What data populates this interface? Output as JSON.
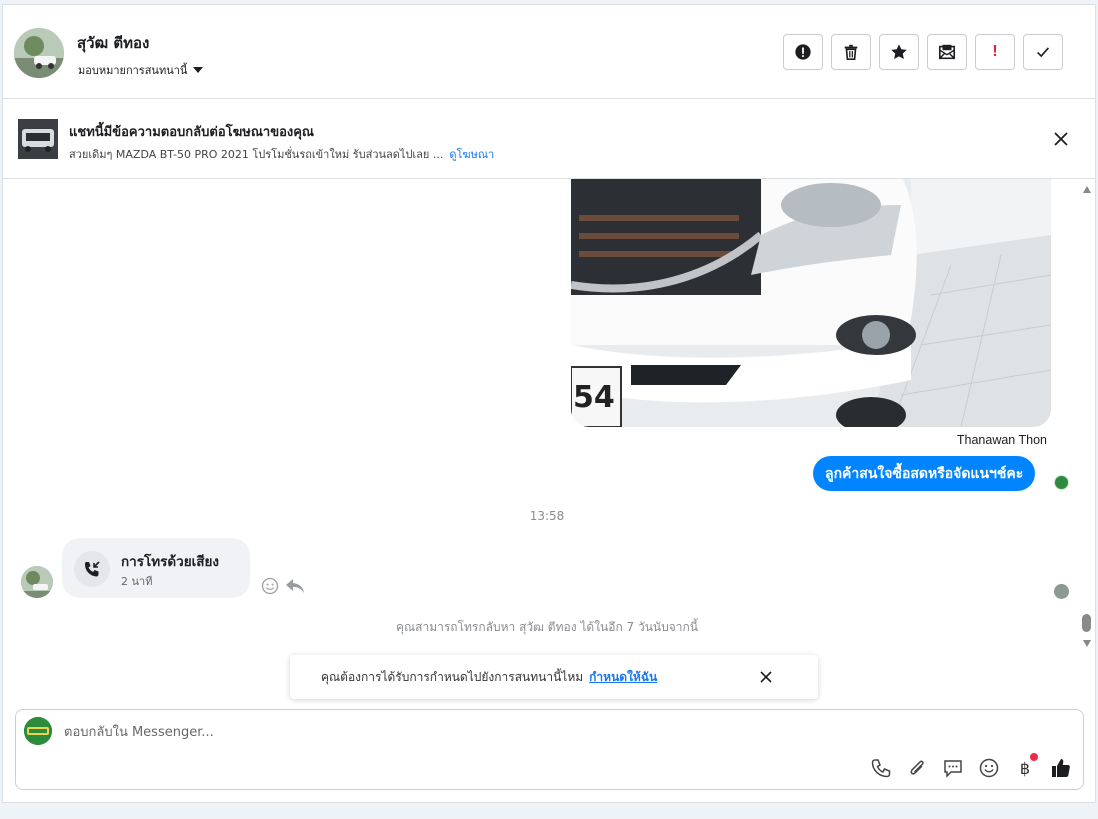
{
  "header": {
    "contact_name": "สุวัฒ ตีทอง",
    "assign_label": "มอบหมายการสนทนานี้",
    "buttons": [
      {
        "name": "report-button",
        "icon": "alert-circle-icon"
      },
      {
        "name": "delete-button",
        "icon": "trash-icon"
      },
      {
        "name": "star-button",
        "icon": "star-icon"
      },
      {
        "name": "mark-unread-button",
        "icon": "envelope-icon"
      },
      {
        "name": "follow-up-button",
        "icon": "exclamation-icon",
        "label": "!"
      },
      {
        "name": "done-button",
        "icon": "check-icon"
      }
    ]
  },
  "ad_banner": {
    "title": "แชทนี้มีข้อความตอบกลับต่อโฆษณาของคุณ",
    "description": "สวยเดิมๆ MAZDA BT-50 PRO 2021 โปรโมชั่นรถเข้าใหม่ รับส่วนลดไปเลย ...",
    "link": "ดูโฆษณา"
  },
  "messages": {
    "photo_plate_text": "54",
    "sender_name": "Thanawan Thon",
    "outgoing_text": "ลูกค้าสนใจซื้อสดหรือจัดแนฯช์คะ",
    "time_divider": "13:58",
    "call": {
      "title": "การโทรด้วยเสียง",
      "duration": "2 นาที"
    },
    "callback_note": "คุณสามารถโทรกลับหา สุวัฒ ตีทอง ได้ในอีก 7 วันนับจากนี้"
  },
  "toast": {
    "text": "คุณต้องการได้รับการกำหนดไปยังการสนทนานี้ไหม",
    "link": "กำหนดให้ฉัน"
  },
  "composer": {
    "placeholder": "ตอบกลับใน Messenger...",
    "tools": [
      "phone-icon",
      "paperclip-icon",
      "saved-reply-icon",
      "emoji-icon",
      "baht-icon",
      "like-icon"
    ],
    "baht_symbol": "฿"
  },
  "colors": {
    "accent": "#0084ff",
    "link": "#1877f2",
    "notification_dot": "#f02849"
  }
}
